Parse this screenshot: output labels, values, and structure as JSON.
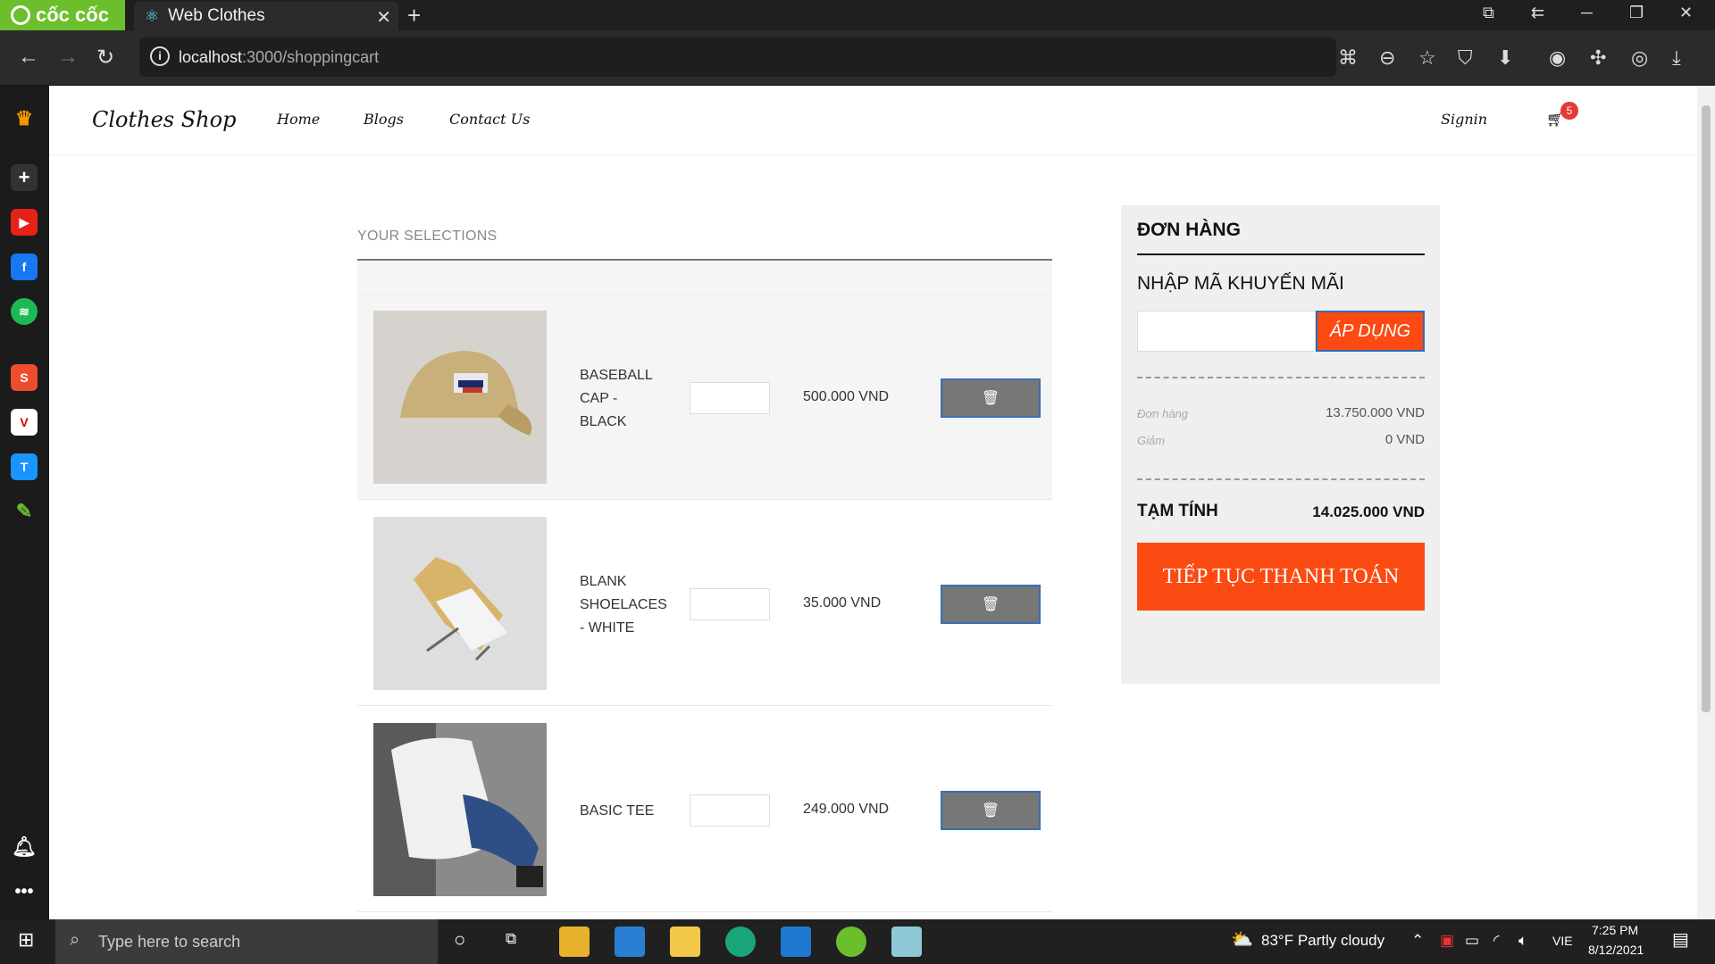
{
  "browser": {
    "brand": "cốc cốc",
    "tab_title": "Web Clothes",
    "url_host": "localhost",
    "url_path": ":3000/shoppingcart"
  },
  "site": {
    "brand": "Clothes Shop",
    "nav": [
      "Home",
      "Blogs",
      "Contact Us"
    ],
    "signin": "Signin",
    "cart_count": "5"
  },
  "cart": {
    "section_title": "YOUR SELECTIONS",
    "items": [
      {
        "name": "BASEBALL CAP - BLACK",
        "price": "500.000 VND",
        "image": "baseball-cap"
      },
      {
        "name": "BLANK SHOELACES - WHITE",
        "price": "35.000 VND",
        "image": "shoelaces"
      },
      {
        "name": "BASIC TEE",
        "price": "249.000 VND",
        "image": "tee"
      }
    ]
  },
  "summary": {
    "title": "ĐƠN HÀNG",
    "promo_label": "NHẬP MÃ KHUYẾN MÃI",
    "promo_button": "ÁP DỤNG",
    "order_label": "Đơn hàng",
    "order_value": "13.750.000 VND",
    "discount_label": "Giảm",
    "discount_value": "0 VND",
    "total_label": "TẠM TÍNH",
    "total_value": "14.025.000 VND",
    "checkout_button": "TIẾP TỤC THANH TOÁN"
  },
  "taskbar": {
    "search_placeholder": "Type here to search",
    "weather": "83°F  Partly cloudy",
    "lang": "VIE",
    "time": "7:25 PM",
    "date": "8/12/2021"
  },
  "colors": {
    "accent": "#fb4a12",
    "coccoc_green": "#6cbf2c",
    "delete_button": "#777777"
  }
}
